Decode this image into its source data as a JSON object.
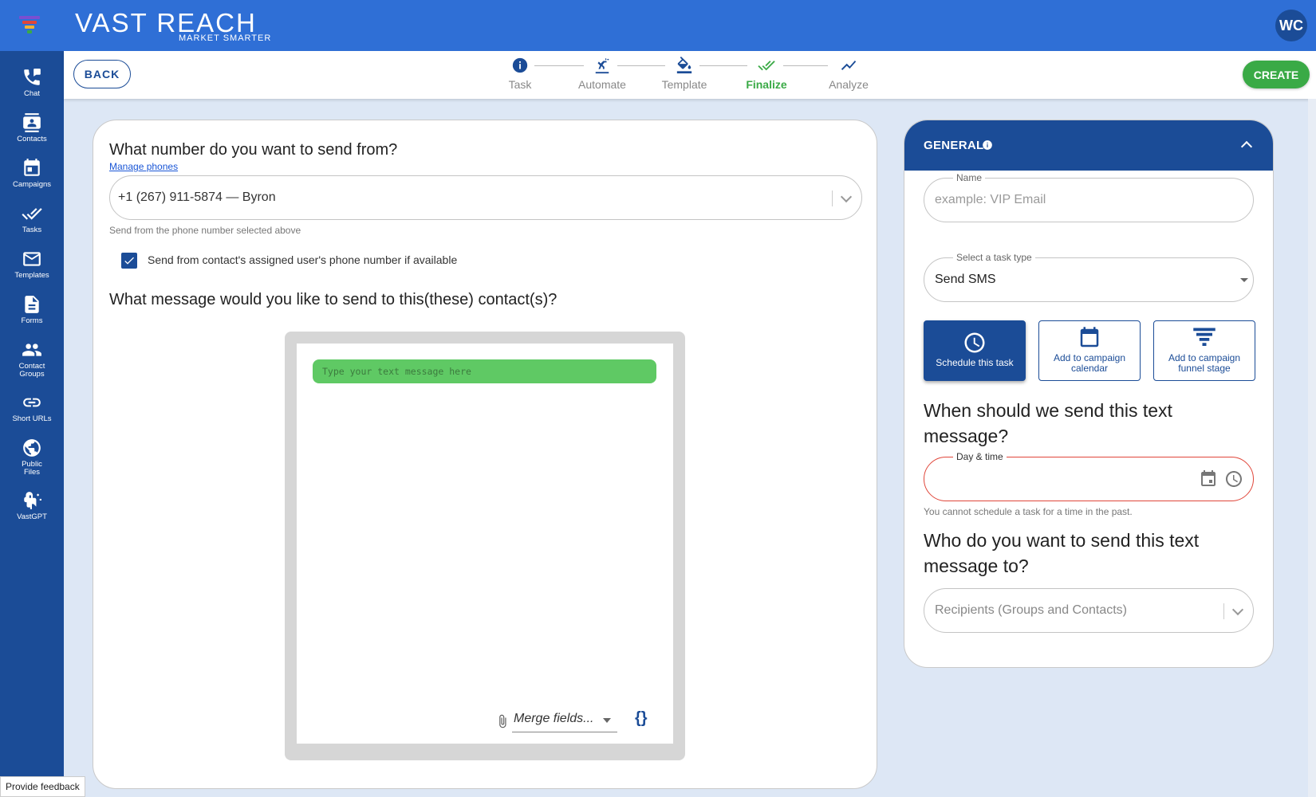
{
  "brand": {
    "name": "VAST REACH",
    "tagline": "MARKET SMARTER"
  },
  "user": {
    "initials": "WC"
  },
  "sidebar": {
    "items": [
      {
        "label": "Chat",
        "icon": "chat-icon"
      },
      {
        "label": "Contacts",
        "icon": "contacts-icon"
      },
      {
        "label": "Campaigns",
        "icon": "campaigns-icon"
      },
      {
        "label": "Tasks",
        "icon": "tasks-icon"
      },
      {
        "label": "Templates",
        "icon": "templates-icon"
      },
      {
        "label": "Forms",
        "icon": "forms-icon"
      },
      {
        "label": "Contact Groups",
        "icon": "contact-groups-icon"
      },
      {
        "label": "Short URLs",
        "icon": "link-icon"
      },
      {
        "label": "Public Files",
        "icon": "globe-icon"
      },
      {
        "label": "VastGPT",
        "icon": "vastgpt-icon"
      }
    ]
  },
  "toolbar": {
    "back_label": "BACK",
    "create_label": "CREATE"
  },
  "stepper": {
    "active": "Finalize",
    "steps": [
      {
        "label": "Task",
        "icon": "info-icon"
      },
      {
        "label": "Automate",
        "icon": "automate-icon"
      },
      {
        "label": "Template",
        "icon": "paint-bucket-icon"
      },
      {
        "label": "Finalize",
        "icon": "double-check-icon"
      },
      {
        "label": "Analyze",
        "icon": "trend-icon"
      }
    ]
  },
  "send_from": {
    "title": "What number do you want to send from?",
    "manage_link": "Manage phones",
    "selected_phone": "+1 (267) 911-5874 — Byron",
    "helper": "Send from the phone number selected above",
    "assigned_checkbox_label": "Send from contact's assigned user's phone number if available",
    "assigned_checked": true
  },
  "message": {
    "title": "What message would you like to send to this(these) contact(s)?",
    "placeholder": "Type your text message here",
    "merge_fields_placeholder": "Merge fields...",
    "braces": "{}"
  },
  "general": {
    "title": "GENERAL",
    "name_label": "Name",
    "name_placeholder": "example: VIP Email",
    "task_type_label": "Select a task type",
    "task_type_value": "Send SMS",
    "options": [
      {
        "label": "Schedule this task",
        "icon": "clock-icon",
        "selected": true
      },
      {
        "label": "Add to campaign calendar",
        "icon": "calendar-icon",
        "selected": false
      },
      {
        "label": "Add to campaign funnel stage",
        "icon": "funnel-icon",
        "selected": false
      }
    ],
    "when_title": "When should we send this text message?",
    "daytime_label": "Day & time",
    "daytime_error": "You cannot schedule a task for a time in the past.",
    "who_title": "Who do you want to send this text message to?",
    "recipients_placeholder": "Recipients (Groups and Contacts)"
  },
  "feedback_label": "Provide feedback",
  "colors": {
    "brand_blue": "#1b4c97",
    "topbar_blue": "#2f6fd6",
    "accent_green": "#3aaa46",
    "error_red": "#e0463a"
  }
}
